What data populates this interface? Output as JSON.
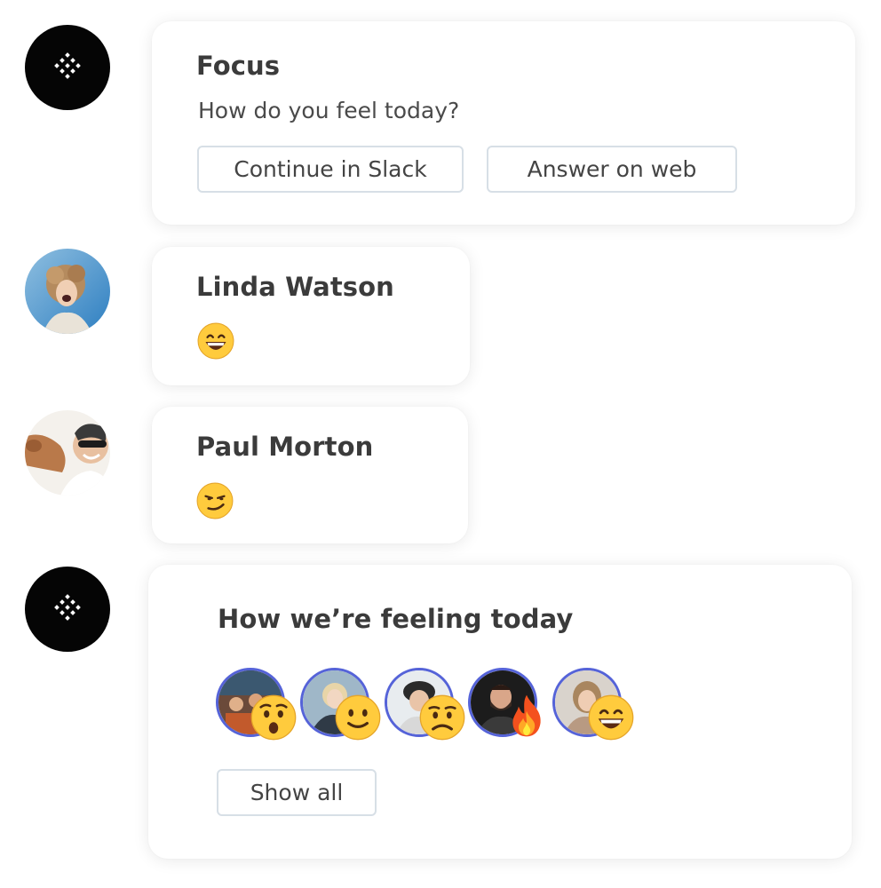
{
  "focus_card": {
    "title": "Focus",
    "question": "How do you feel today?",
    "continue_slack_label": "Continue in Slack",
    "answer_web_label": "Answer on web"
  },
  "messages": [
    {
      "name": "Linda Watson",
      "reaction_icon": "grinning-face-icon"
    },
    {
      "name": "Paul Morton",
      "reaction_icon": "smirking-face-icon"
    }
  ],
  "summary_card": {
    "title": "How we’re feeling today",
    "show_all_label": "Show all",
    "reactions": [
      {
        "avatar": "team-photo-avatar",
        "emoji": "hushed-face-icon"
      },
      {
        "avatar": "woman-blonde-avatar",
        "emoji": "slightly-smiling-face-icon"
      },
      {
        "avatar": "man-hat-avatar",
        "emoji": "worried-face-icon"
      },
      {
        "avatar": "man-beard-avatar",
        "emoji": "fire-icon"
      },
      {
        "avatar": "woman-smiling-avatar",
        "emoji": "grinning-face-icon"
      }
    ]
  },
  "colors": {
    "bot_avatar": "#050505",
    "ring": "#5563d8",
    "button_border": "#d7dfe6",
    "emoji_yellow": "#ffcb3d"
  }
}
